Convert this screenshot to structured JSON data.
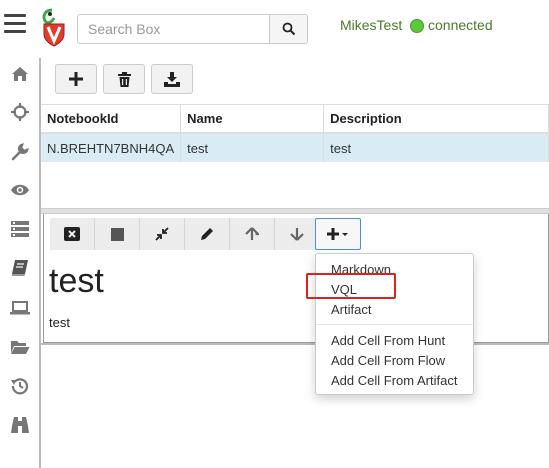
{
  "header": {
    "search_placeholder": "Search Box",
    "user": "MikesTest",
    "status": "connected"
  },
  "sidebar": {
    "items": [
      "home-icon",
      "crosshair-icon",
      "wrench-icon",
      "eye-icon",
      "server-icon",
      "notebook-icon",
      "laptop-icon",
      "folder-open-icon",
      "history-icon",
      "binoculars-icon"
    ]
  },
  "notebooks": {
    "toolbar": [
      "add-icon",
      "trash-icon",
      "download-icon"
    ],
    "columns": [
      "NotebookId",
      "Name",
      "Description"
    ],
    "rows": [
      [
        "N.BREHTN7BNH4QA",
        "test",
        "test"
      ]
    ]
  },
  "cell": {
    "toolbar": [
      "close-cell-icon",
      "stop-icon",
      "compress-icon",
      "pencil-icon",
      "arrow-up-icon",
      "arrow-down-icon",
      "add-cell-icon"
    ],
    "title": "test",
    "body": "test"
  },
  "add_menu": {
    "items": [
      "Markdown",
      "VQL",
      "Artifact"
    ],
    "more_items": [
      "Add Cell From Hunt",
      "Add Cell From Flow",
      "Add Cell From Artifact"
    ],
    "highlighted": "VQL"
  },
  "colors": {
    "selected_row": "#d9ecf5",
    "status_green": "#5cc93a",
    "highlight_red": "#e02020",
    "accent_blue": "#4a90d9"
  }
}
